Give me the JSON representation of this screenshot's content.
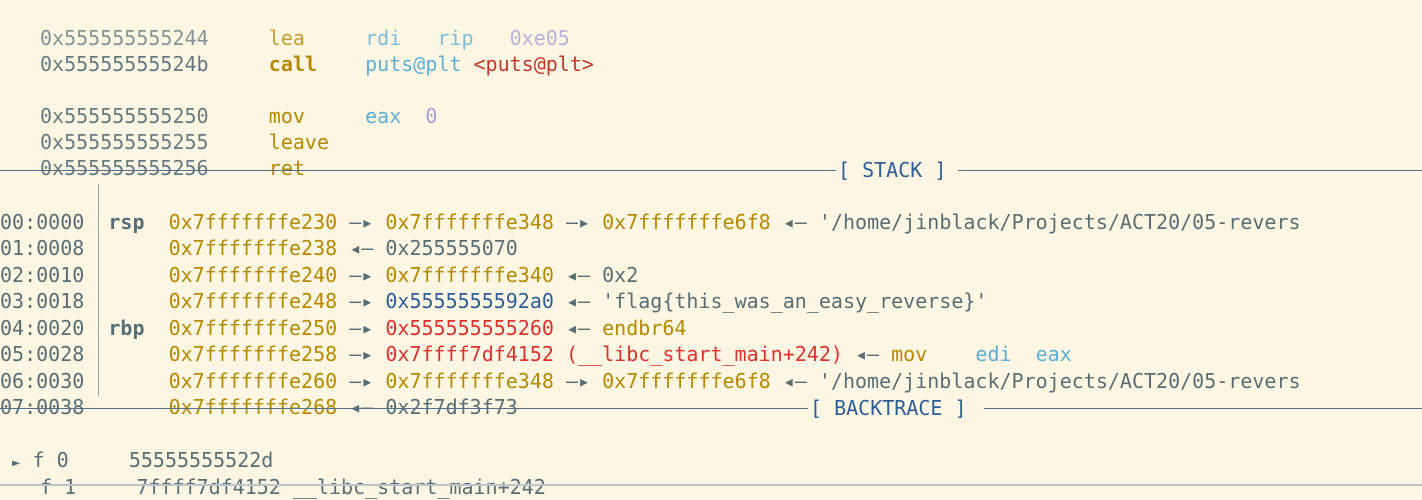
{
  "disasm": [
    {
      "addr": "0x555555555244",
      "op": "lea",
      "a1": "rdi",
      "a2": "rip",
      "a3": "0xe05",
      "op_style": "normal",
      "faded": true
    },
    {
      "addr": "0x55555555524b",
      "op": "call",
      "a1": "puts@plt",
      "a2": "<puts@plt>",
      "op_style": "bold",
      "faded": false
    },
    {
      "addr": "0x555555555250",
      "op": "mov",
      "a1": "eax",
      "a2": "0",
      "op_style": "normal",
      "faded": false
    },
    {
      "addr": "0x555555555255",
      "op": "leave",
      "op_style": "normal",
      "faded": false
    },
    {
      "addr": "0x555555555256",
      "op": "ret",
      "op_style": "normal",
      "faded": false
    }
  ],
  "stack_header": "[ STACK ]",
  "stack": [
    {
      "idx": "00:0000",
      "reg": "rsp",
      "addr": "0x7fffffffe230",
      "arrow1": "—▸",
      "v1": "0x7fffffffe348",
      "arrow2": "—▸",
      "v2": "0x7fffffffe6f8",
      "arrow3": "◂—",
      "v3": "'/home/jinblack/Projects/ACT20/05-revers"
    },
    {
      "idx": "01:0008",
      "reg": "",
      "addr": "0x7fffffffe238",
      "arrow1": "◂—",
      "v1": "0x255555070"
    },
    {
      "idx": "02:0010",
      "reg": "",
      "addr": "0x7fffffffe240",
      "arrow1": "—▸",
      "v1": "0x7fffffffe340",
      "arrow2": "◂—",
      "v2": "0x2"
    },
    {
      "idx": "03:0018",
      "reg": "",
      "addr": "0x7fffffffe248",
      "arrow1": "—▸",
      "v1": "0x5555555592a0",
      "arrow2": "◂—",
      "v2": "'flag{this_was_an_easy_reverse}'"
    },
    {
      "idx": "04:0020",
      "reg": "rbp",
      "addr": "0x7fffffffe250",
      "arrow1": "—▸",
      "v1": "0x555555555260",
      "arrow2": "◂—",
      "v2": "endbr64"
    },
    {
      "idx": "05:0028",
      "reg": "",
      "addr": "0x7fffffffe258",
      "arrow1": "—▸",
      "v1": "0x7ffff7df4152",
      "v1b": "(__libc_start_main+242)",
      "arrow2": "◂—",
      "v2": "mov",
      "v3": "edi",
      "v4": "eax"
    },
    {
      "idx": "06:0030",
      "reg": "",
      "addr": "0x7fffffffe260",
      "arrow1": "—▸",
      "v1": "0x7fffffffe348",
      "arrow2": "—▸",
      "v2": "0x7fffffffe6f8",
      "arrow3": "◂—",
      "v3": "'/home/jinblack/Projects/ACT20/05-revers"
    },
    {
      "idx": "07:0038",
      "reg": "",
      "addr": "0x7fffffffe268",
      "arrow1": "◂—",
      "v1": "0x2f7df3f73"
    }
  ],
  "backtrace_header": "[ BACKTRACE ]",
  "backtrace": [
    {
      "marker": "►",
      "frame": "f 0",
      "addr": "55555555522d",
      "sym": ""
    },
    {
      "marker": "",
      "frame": "f 1",
      "addr": "7ffff7df4152",
      "sym": "__libc_start_main+242"
    }
  ],
  "colors": {
    "background": "#fdf6e3",
    "address": "#b58900",
    "separator": "#2d5e9a"
  }
}
